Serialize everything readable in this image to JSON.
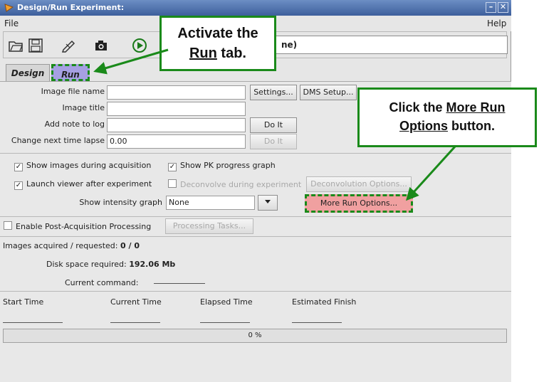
{
  "window": {
    "title": "Design/Run Experiment:"
  },
  "menu": {
    "file": "File",
    "help": "Help"
  },
  "toolbar": {
    "experiment_name": "ne)"
  },
  "tabs": {
    "design": "Design",
    "run": "Run"
  },
  "form": {
    "image_file_name_label": "Image file name",
    "image_title_label": "Image title",
    "add_note_label": "Add note to log",
    "change_lapse_label": "Change next time lapse",
    "change_lapse_value": "0.00",
    "settings_button": "Settings...",
    "dms_button": "DMS Setup...",
    "do_it_button": "Do It",
    "do_it_button_2": "Do It"
  },
  "options": {
    "show_images": "Show images during acquisition",
    "show_pk": "Show PK progress graph",
    "launch_viewer": "Launch viewer after experiment",
    "deconvolve": "Deconvolve during experiment",
    "deconv_options_button": "Deconvolution Options...",
    "intensity_label": "Show intensity graph",
    "intensity_value": "None",
    "more_run_button": "More Run Options...",
    "post_acq": "Enable Post-Acquisition Processing",
    "processing_tasks_button": "Processing Tasks..."
  },
  "status": {
    "images_label": "Images acquired / requested:",
    "images_value": "0 / 0",
    "disk_label": "Disk space required:",
    "disk_value": "192.06 Mb",
    "command_label": "Current command:"
  },
  "times": {
    "start": "Start Time",
    "current": "Current Time",
    "elapsed": "Elapsed Time",
    "finish": "Estimated Finish"
  },
  "progress": {
    "text": "0 %",
    "fraction": 0
  },
  "callouts": {
    "run_tab_line1": "Activate the",
    "run_tab_word": "Run",
    "run_tab_rest": " tab.",
    "more_run_pre": "Click the ",
    "more_run_word1": "More Run",
    "more_run_word2": "Options",
    "more_run_rest": " button."
  },
  "colors": {
    "callout_border": "#1a8a1a",
    "run_tab": "#a6a0e2",
    "more_run_button": "#f0a0a0",
    "titlebar": "#4a6ca8"
  }
}
